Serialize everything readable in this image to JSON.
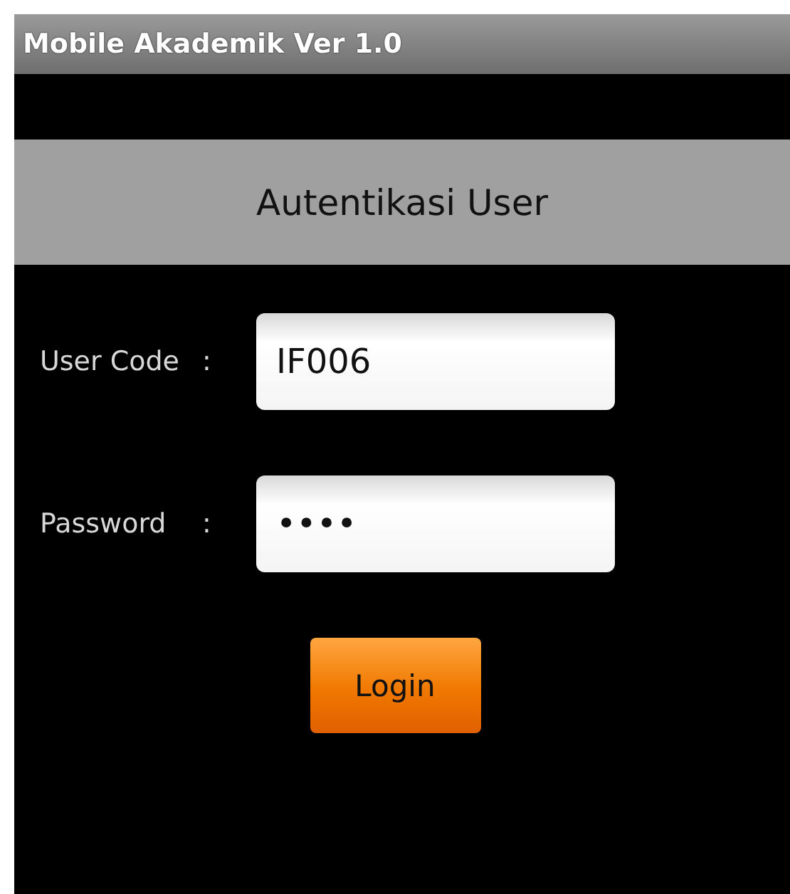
{
  "window": {
    "title": "Mobile Akademik Ver 1.0"
  },
  "header": {
    "title": "Autentikasi User"
  },
  "fields": [
    {
      "label": "User Code",
      "separator": ":",
      "value": "IF006"
    },
    {
      "label": "Password",
      "separator": ":",
      "value": "••••"
    }
  ],
  "buttons": [
    "Login"
  ]
}
